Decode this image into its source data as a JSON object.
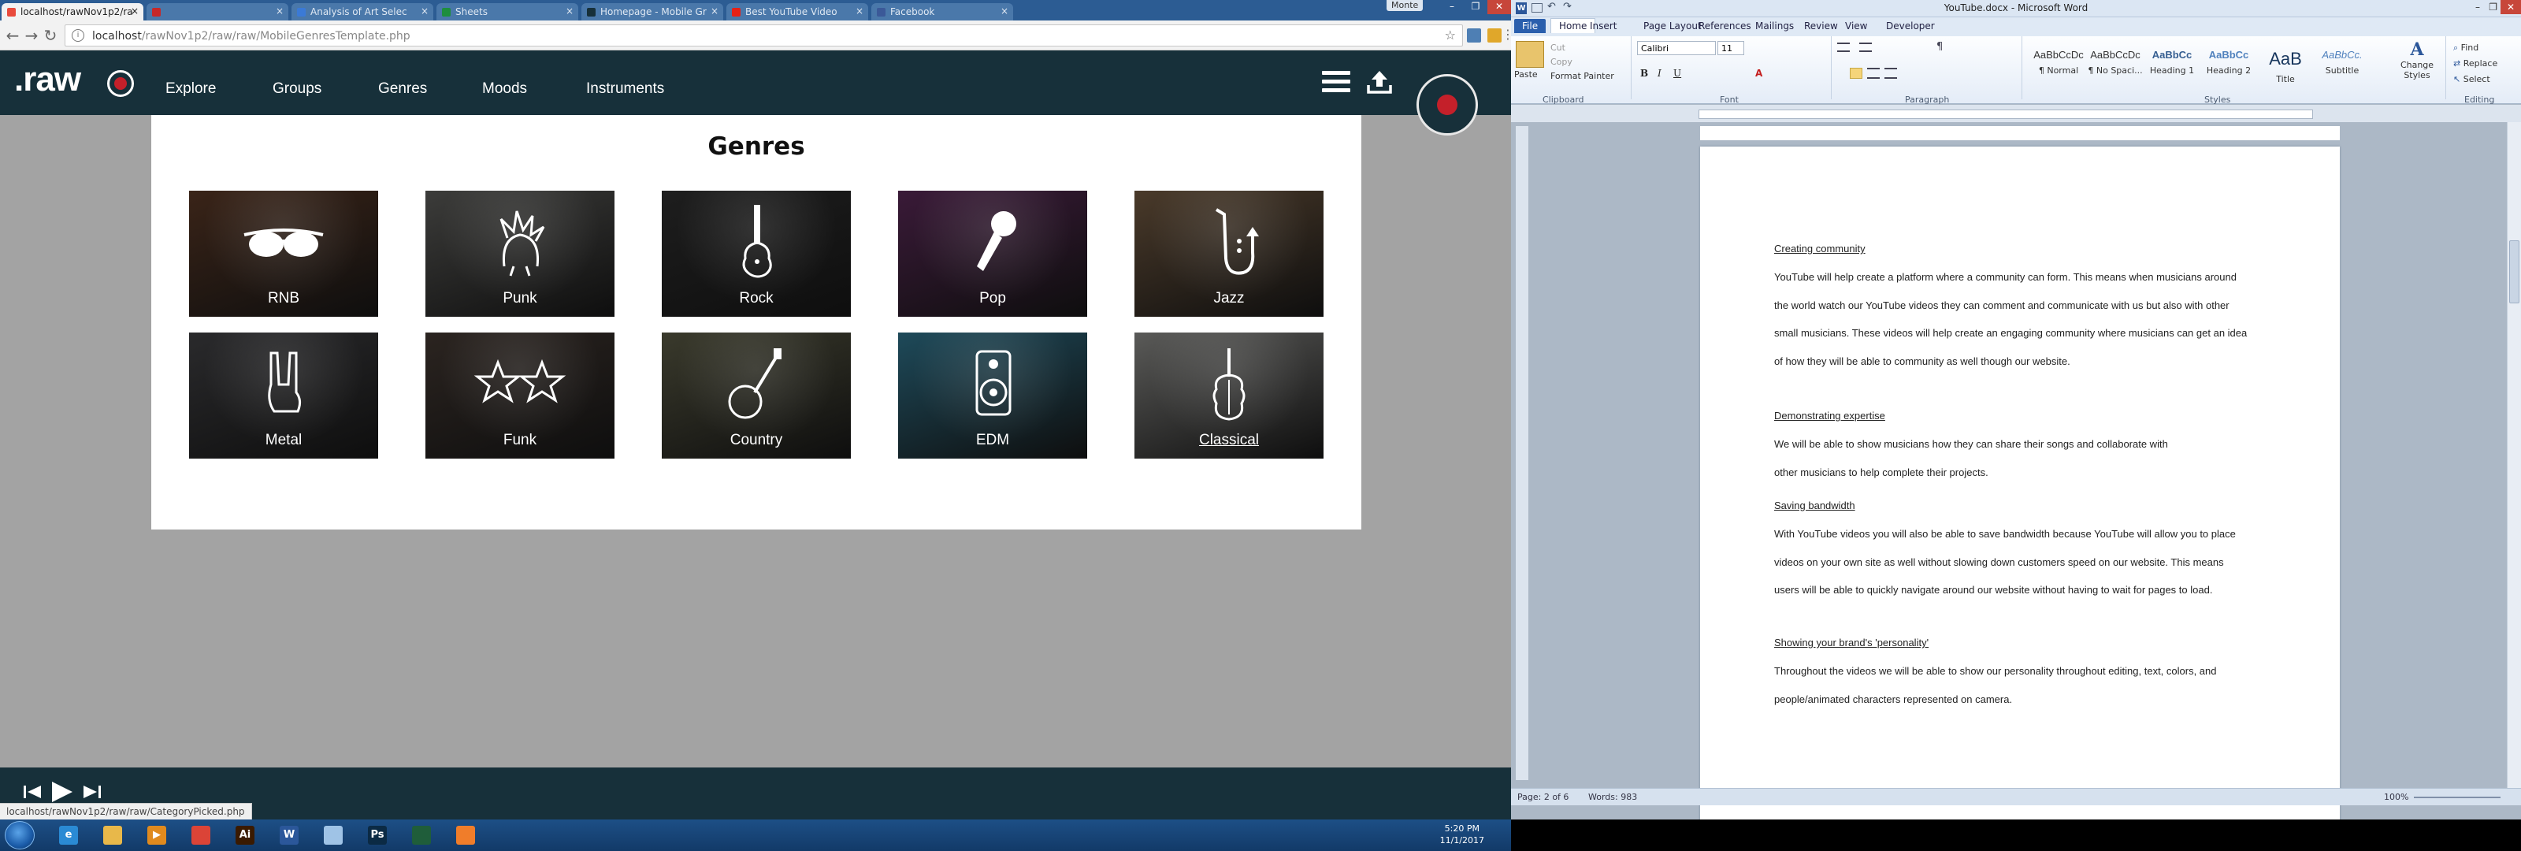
{
  "browser": {
    "tabs": [
      {
        "label": "localhost/rawNov1p2/ra",
        "state": "active",
        "favicon_color": "#e94b3c"
      },
      {
        "label": "",
        "state": "inactive",
        "favicon_color": "#c62828"
      },
      {
        "label": "Analysis of Art Selec",
        "state": "inactive",
        "favicon_color": "#3b7ad6"
      },
      {
        "label": "Sheets",
        "state": "inactive",
        "favicon_color": "#1e8e3e"
      },
      {
        "label": "Homepage - Mobile Gr",
        "state": "inactive",
        "favicon_color": "#17303a"
      },
      {
        "label": "Best YouTube Video",
        "state": "inactive",
        "favicon_color": "#e62117"
      },
      {
        "label": "Facebook",
        "state": "inactive",
        "favicon_color": "#3b5998"
      }
    ],
    "profile_label": "Monte",
    "url_host": "localhost",
    "url_path": "/rawNov1p2/raw/raw/MobileGenresTemplate.php",
    "status_url": "localhost/rawNov1p2/raw/raw/CategoryPicked.php"
  },
  "site": {
    "logo": ".raw",
    "nav_links": [
      "Explore",
      "Groups",
      "Genres",
      "Moods",
      "Instruments"
    ],
    "page_title": "Genres",
    "genres": [
      {
        "label": "RNB",
        "icon": "sunglasses-icon",
        "bg": "#3a2418"
      },
      {
        "label": "Punk",
        "icon": "mohawk-head-icon",
        "bg": "#3c3c3a"
      },
      {
        "label": "Rock",
        "icon": "electric-guitar-icon",
        "bg": "#1e1e1e"
      },
      {
        "label": "Pop",
        "icon": "microphone-icon",
        "bg": "#3a1a38"
      },
      {
        "label": "Jazz",
        "icon": "saxophone-icon",
        "bg": "#4a3a2a"
      },
      {
        "label": "Metal",
        "icon": "rock-hand-icon",
        "bg": "#2a2a2c"
      },
      {
        "label": "Funk",
        "icon": "two-stars-icon",
        "bg": "#2b2420"
      },
      {
        "label": "Country",
        "icon": "banjo-icon",
        "bg": "#3a3a2c"
      },
      {
        "label": "EDM",
        "icon": "speaker-icon",
        "bg": "#1e4a5a"
      },
      {
        "label": "Classical",
        "icon": "violin-icon",
        "bg": "#5a5a58"
      }
    ],
    "accent_red": "#c4202a",
    "nav_bg": "#17303a"
  },
  "word": {
    "title": "YouTube.docx - Microsoft Word",
    "tabs": [
      "File",
      "Home",
      "Insert",
      "Page Layout",
      "References",
      "Mailings",
      "Review",
      "View",
      "Developer"
    ],
    "clipboard": {
      "paste": "Paste",
      "cut": "Cut",
      "copy": "Copy",
      "format_painter": "Format Painter"
    },
    "font_name": "Calibri",
    "font_size": "11",
    "styles": [
      {
        "sample": "AaBbCcDc",
        "name": "¶ Normal"
      },
      {
        "sample": "AaBbCcDc",
        "name": "¶ No Spaci..."
      },
      {
        "sample": "AaBbCc",
        "name": "Heading 1"
      },
      {
        "sample": "AaBbCc",
        "name": "Heading 2"
      },
      {
        "sample": "AaB",
        "name": "Title"
      },
      {
        "sample": "AaBbCc.",
        "name": "Subtitle"
      }
    ],
    "change_styles": "Change Styles",
    "editing": {
      "find": "Find",
      "replace": "Replace",
      "select": "Select"
    },
    "groups": [
      "Clipboard",
      "Font",
      "Paragraph",
      "Styles",
      "Editing"
    ],
    "document": [
      {
        "heading": "Creating community",
        "lines": [
          "YouTube will help create a platform where a community can form. This means when musicians around",
          "the world watch our YouTube videos they can comment and communicate with us but also with other",
          "small musicians. These videos will help create an engaging community where musicians can get an idea",
          "of how they will be able to community as well though our website."
        ]
      },
      {
        "heading": "Demonstrating expertise",
        "lines": [
          "We will be able to show musicians how they can share their songs and collaborate with",
          "other musicians to help complete their projects."
        ]
      },
      {
        "heading": "Saving bandwidth",
        "lines": [
          "With YouTube videos you will also be able to save bandwidth because YouTube will allow you to place",
          "videos on your own site as well without slowing down customers speed on our website. This means",
          "users will be able to quickly navigate around our website without having to wait for pages to load."
        ]
      },
      {
        "heading": "Showing your brand's 'personality'",
        "lines": [
          "Throughout the videos we will be able to show our personality throughout editing, text, colors, and",
          "people/animated characters represented on camera."
        ]
      }
    ],
    "status": {
      "page": "Page: 2 of 6",
      "words": "Words: 983",
      "zoom": "100%"
    }
  },
  "taskbar": {
    "apps": [
      {
        "name": "internet-explorer-icon",
        "color": "#2a8ad4",
        "glyph": "e"
      },
      {
        "name": "file-explorer-icon",
        "color": "#e8b84a",
        "glyph": ""
      },
      {
        "name": "media-player-icon",
        "color": "#e08a1e",
        "glyph": "▶"
      },
      {
        "name": "chrome-icon",
        "color": "#db4437",
        "glyph": ""
      },
      {
        "name": "illustrator-icon",
        "color": "#3a1a00",
        "glyph": "Ai"
      },
      {
        "name": "word-icon",
        "color": "#2b579a",
        "glyph": "W"
      },
      {
        "name": "paint-icon",
        "color": "#9fc3e6",
        "glyph": ""
      },
      {
        "name": "photoshop-icon",
        "color": "#0b2a44",
        "glyph": "Ps"
      },
      {
        "name": "gimp-icon",
        "color": "#1f5d3a",
        "glyph": ""
      },
      {
        "name": "xampp-icon",
        "color": "#f07d2a",
        "glyph": ""
      }
    ],
    "time": "5:20 PM",
    "date": "11/1/2017"
  }
}
